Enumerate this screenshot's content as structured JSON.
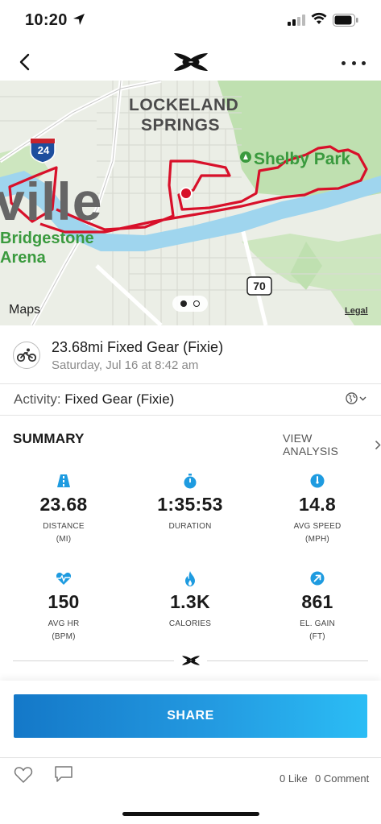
{
  "status_bar": {
    "time": "10:20"
  },
  "map": {
    "neighborhood_label_1": "LOCKELAND",
    "neighborhood_label_2": "SPRINGS",
    "park_label": "Shelby Park",
    "city_label": "ville",
    "arena_label_1": "Bridgestone",
    "arena_label_2": "Arena",
    "interstate_shield": "24",
    "route_shield": "70",
    "attribution": "Maps",
    "legal": "Legal"
  },
  "workout": {
    "title": "23.68mi Fixed Gear (Fixie)",
    "date": "Saturday, Jul 16 at 8:42 am",
    "activity_label": "Activity:",
    "activity_value": "Fixed Gear (Fixie)"
  },
  "summary": {
    "title": "SUMMARY",
    "view_analysis": "VIEW ANALYSIS",
    "stats": [
      {
        "icon": "road-icon",
        "value": "23.68",
        "label": "DISTANCE",
        "unit": "(MI)"
      },
      {
        "icon": "stopwatch-icon",
        "value": "1:35:53",
        "label": "DURATION",
        "unit": ""
      },
      {
        "icon": "speedometer-icon",
        "value": "14.8",
        "label": "AVG SPEED",
        "unit": "(MPH)"
      },
      {
        "icon": "heart-rate-icon",
        "value": "150",
        "label": "AVG HR",
        "unit": "(BPM)"
      },
      {
        "icon": "flame-icon",
        "value": "1.3K",
        "label": "CALORIES",
        "unit": ""
      },
      {
        "icon": "elevation-arrow-icon",
        "value": "861",
        "label": "EL. GAIN",
        "unit": "(FT)"
      }
    ]
  },
  "share": {
    "label": "SHARE"
  },
  "social": {
    "likes": "0 Like",
    "comments": "0 Comment"
  },
  "colors": {
    "accent_blue": "#1e9be0",
    "route_red": "#d8102a",
    "park_green": "#3a9a3e"
  }
}
